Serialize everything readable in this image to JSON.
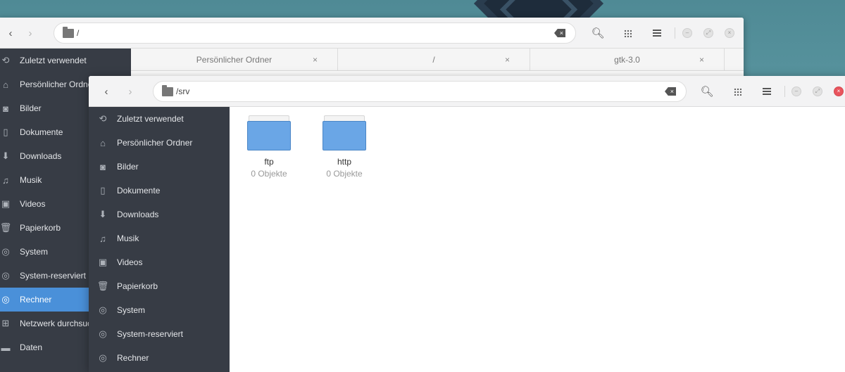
{
  "colors": {
    "sidebar_bg": "#373c45",
    "accent": "#4a90d9",
    "folder": "#6aa6e6",
    "close_red": "#e9545d"
  },
  "back_window": {
    "path": "/",
    "tabs": [
      {
        "label": "Persönlicher Ordner",
        "close": "×"
      },
      {
        "label": "/",
        "close": "×"
      },
      {
        "label": "gtk-3.0",
        "close": "×"
      }
    ],
    "sidebar": [
      {
        "label": "Zuletzt verwendet",
        "icon": "recent-icon"
      },
      {
        "label": "Persönlicher Ordner",
        "icon": "home-icon"
      },
      {
        "label": "Bilder",
        "icon": "camera-icon"
      },
      {
        "label": "Dokumente",
        "icon": "document-icon"
      },
      {
        "label": "Downloads",
        "icon": "download-icon"
      },
      {
        "label": "Musik",
        "icon": "music-icon"
      },
      {
        "label": "Videos",
        "icon": "video-icon"
      },
      {
        "label": "Papierkorb",
        "icon": "trash-icon"
      },
      {
        "label": "System",
        "icon": "drive-icon"
      },
      {
        "label": "System-reserviert",
        "icon": "drive-icon"
      },
      {
        "label": "Rechner",
        "icon": "computer-icon"
      },
      {
        "label": "Netzwerk durchsuchen",
        "icon": "network-icon"
      },
      {
        "label": "Daten",
        "icon": "folder-icon"
      }
    ],
    "active_sidebar_item": "Rechner"
  },
  "front_window": {
    "path": "/srv",
    "sidebar": [
      {
        "label": "Zuletzt verwendet",
        "icon": "recent-icon"
      },
      {
        "label": "Persönlicher Ordner",
        "icon": "home-icon"
      },
      {
        "label": "Bilder",
        "icon": "camera-icon"
      },
      {
        "label": "Dokumente",
        "icon": "document-icon"
      },
      {
        "label": "Downloads",
        "icon": "download-icon"
      },
      {
        "label": "Musik",
        "icon": "music-icon"
      },
      {
        "label": "Videos",
        "icon": "video-icon"
      },
      {
        "label": "Papierkorb",
        "icon": "trash-icon"
      },
      {
        "label": "System",
        "icon": "drive-icon"
      },
      {
        "label": "System-reserviert",
        "icon": "drive-icon"
      },
      {
        "label": "Rechner",
        "icon": "drive-icon"
      }
    ],
    "files": [
      {
        "name": "ftp",
        "meta": "0 Objekte"
      },
      {
        "name": "http",
        "meta": "0 Objekte"
      }
    ]
  }
}
